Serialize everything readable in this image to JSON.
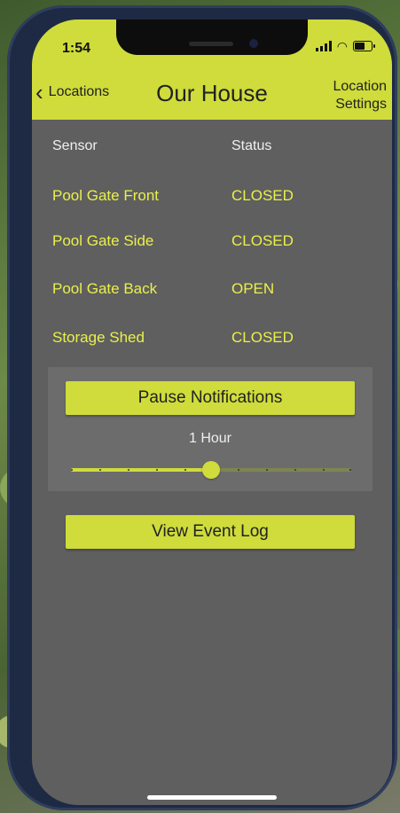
{
  "status_bar": {
    "time": "1:54"
  },
  "header": {
    "back_label": "Locations",
    "title": "Our House",
    "settings_line1": "Location",
    "settings_line2": "Settings"
  },
  "table": {
    "col_sensor": "Sensor",
    "col_status": "Status",
    "rows": [
      {
        "sensor": "Pool Gate Front",
        "status": "CLOSED"
      },
      {
        "sensor": "Pool Gate Side",
        "status": "CLOSED"
      },
      {
        "sensor": "Pool Gate Back",
        "status": "OPEN"
      },
      {
        "sensor": "Storage Shed",
        "status": "CLOSED"
      }
    ]
  },
  "pause": {
    "button_label": "Pause Notifications",
    "duration_label": "1 Hour",
    "slider_fraction": 0.5
  },
  "event_log": {
    "button_label": "View Event Log"
  },
  "colors": {
    "accent": "#cfdc3b",
    "background": "#5f5f5f",
    "value_text": "#eaf04a"
  }
}
